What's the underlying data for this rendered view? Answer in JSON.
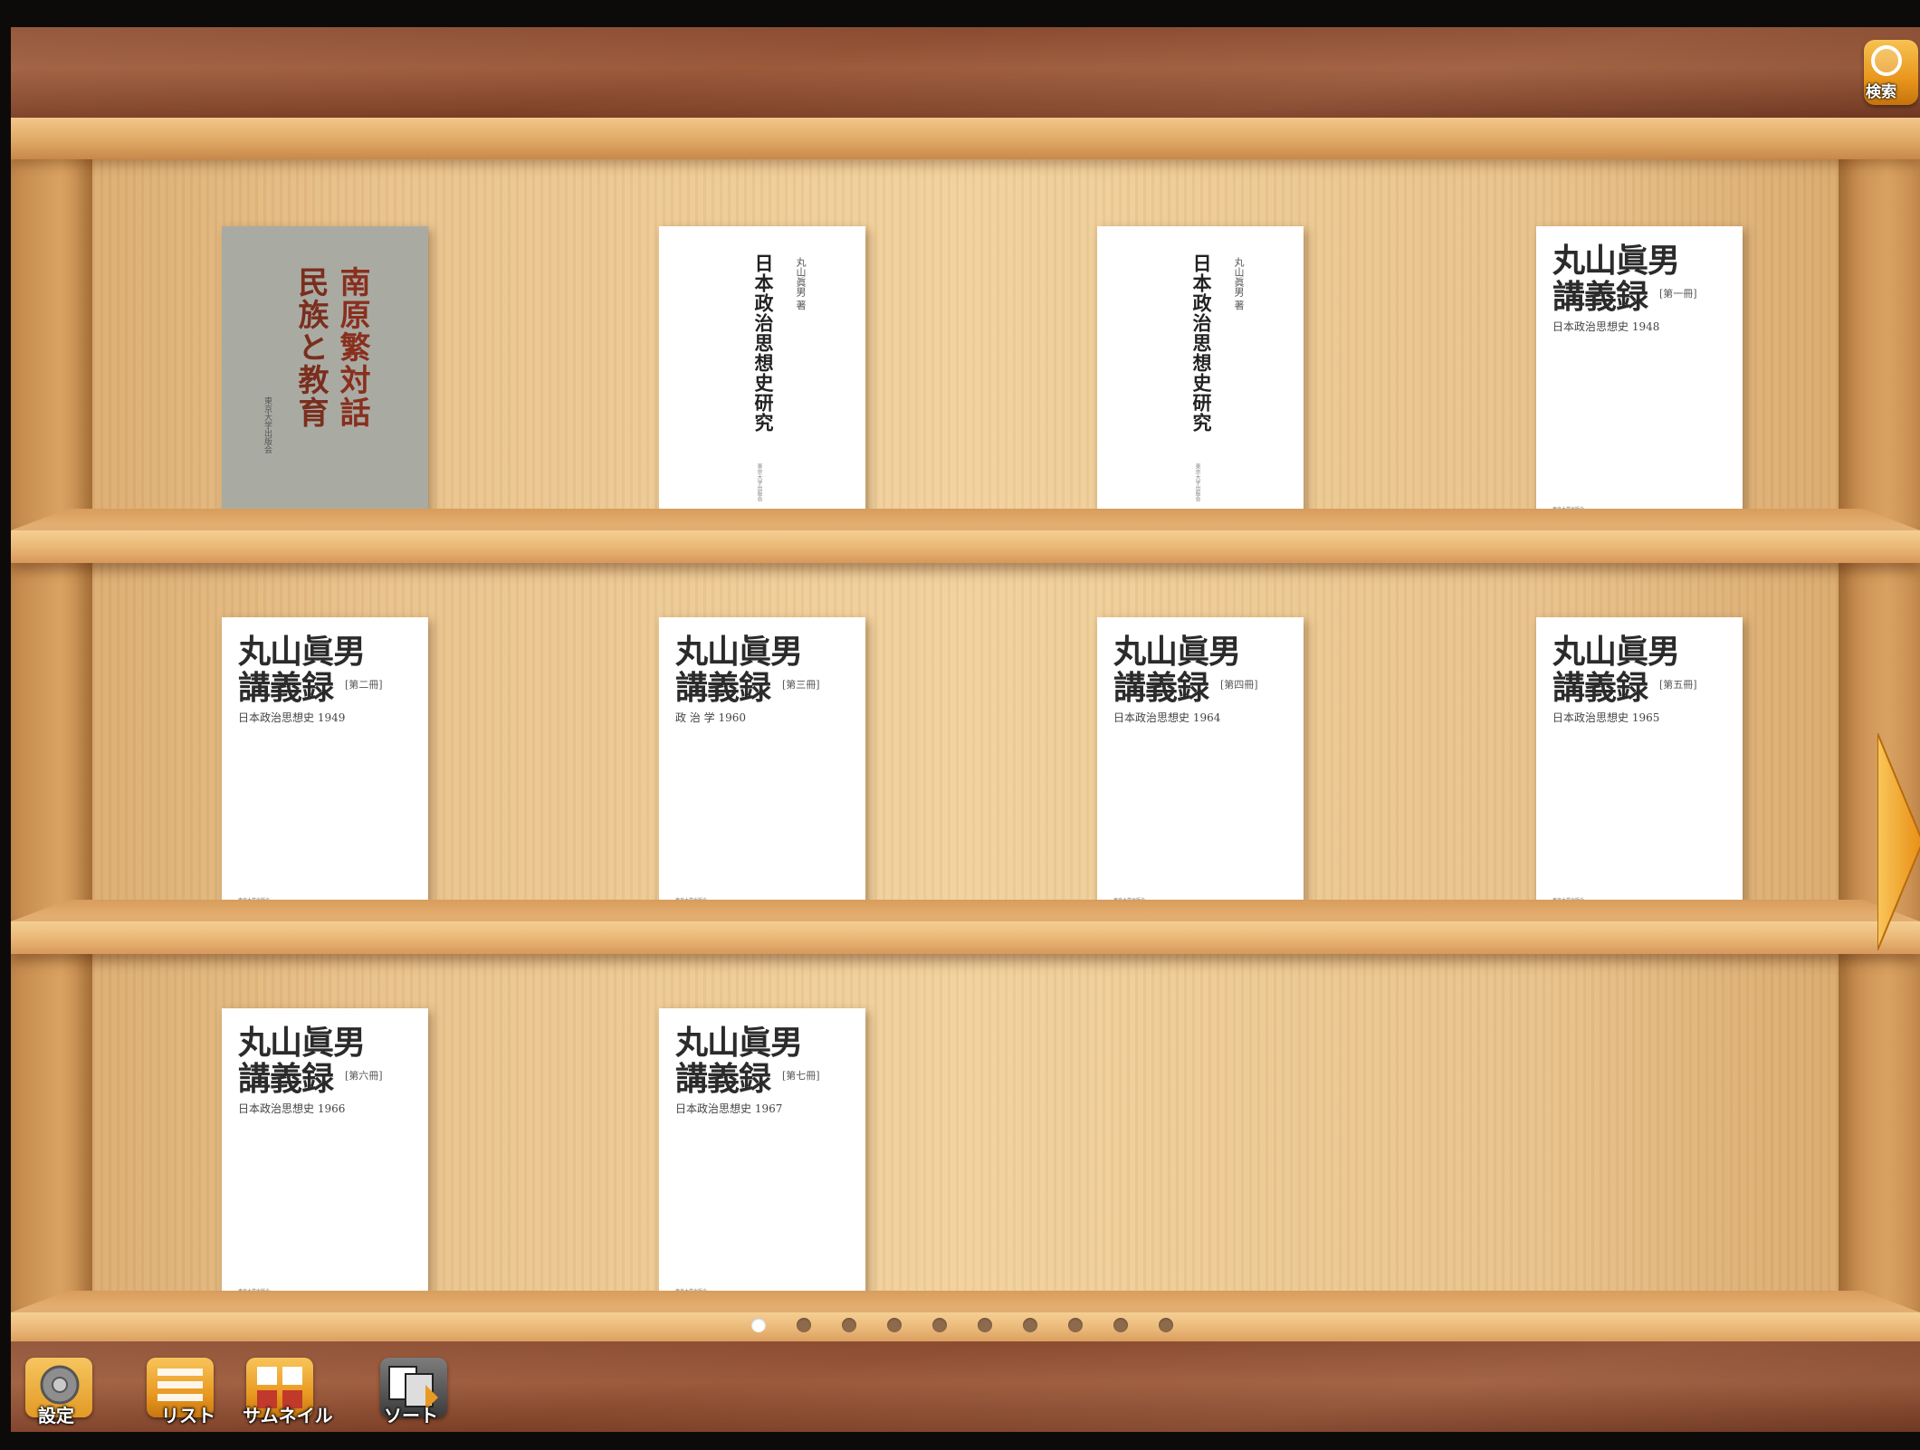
{
  "toolbar_top": {
    "search_label": "検索"
  },
  "shelves": {
    "row1": [
      {
        "cover": "gray",
        "title_a": "南原繁対話",
        "title_b": "民族と教育",
        "publisher": "東京大学出版会"
      },
      {
        "cover": "white-vertical",
        "title": "日本政治思想史研究",
        "author": "丸山眞男 著",
        "publisher": "東京大学出版会"
      },
      {
        "cover": "white-vertical",
        "title": "日本政治思想史研究",
        "author": "丸山眞男 著",
        "publisher": "東京大学出版会"
      },
      {
        "cover": "lecture",
        "series": "丸山眞男",
        "title": "講義録",
        "volume": "[第一冊]",
        "subtitle": "日本政治思想史 1948",
        "publisher": "東京大学出版会"
      }
    ],
    "row2": [
      {
        "cover": "lecture",
        "series": "丸山眞男",
        "title": "講義録",
        "volume": "[第二冊]",
        "subtitle": "日本政治思想史 1949",
        "publisher": "東京大学出版会"
      },
      {
        "cover": "lecture",
        "series": "丸山眞男",
        "title": "講義録",
        "volume": "[第三冊]",
        "subtitle": "政 治 学 1960",
        "publisher": "東京大学出版会"
      },
      {
        "cover": "lecture",
        "series": "丸山眞男",
        "title": "講義録",
        "volume": "[第四冊]",
        "subtitle": "日本政治思想史 1964",
        "publisher": "東京大学出版会"
      },
      {
        "cover": "lecture",
        "series": "丸山眞男",
        "title": "講義録",
        "volume": "[第五冊]",
        "subtitle": "日本政治思想史 1965",
        "publisher": "東京大学出版会"
      }
    ],
    "row3": [
      {
        "cover": "lecture",
        "series": "丸山眞男",
        "title": "講義録",
        "volume": "[第六冊]",
        "subtitle": "日本政治思想史 1966",
        "publisher": "東京大学出版会"
      },
      {
        "cover": "lecture",
        "series": "丸山眞男",
        "title": "講義録",
        "volume": "[第七冊]",
        "subtitle": "日本政治思想史 1967",
        "publisher": "東京大学出版会"
      }
    ]
  },
  "pagination": {
    "pages": 10,
    "current": 1
  },
  "toolbar_bottom": {
    "settings_label": "設定",
    "list_label": "リスト",
    "thumbnail_label": "サムネイル",
    "sort_label": "ソート"
  },
  "colors": {
    "accent": "#e9961c",
    "wood_light": "#f2d29d",
    "wood_dark": "#8a4b30"
  },
  "icons": {
    "search": "magnifier-icon",
    "settings": "gear-icon",
    "list": "list-icon",
    "thumbnail": "thumbnail-grid-icon",
    "sort": "sort-icon",
    "next": "arrow-right-icon"
  }
}
